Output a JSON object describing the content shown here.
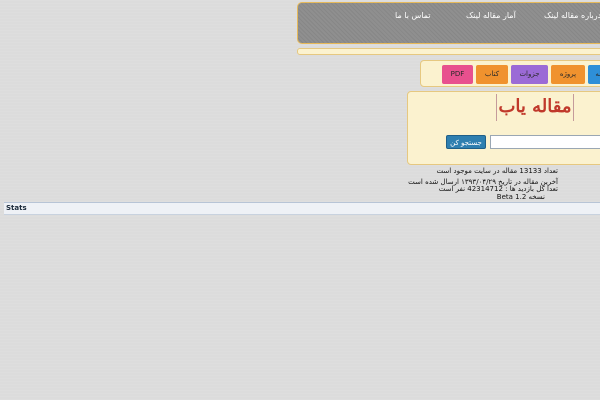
{
  "nav": {
    "items": [
      {
        "label": "درباره مقاله لینک"
      },
      {
        "label": "آمار مقاله لینک"
      },
      {
        "label": "تماس با ما"
      }
    ]
  },
  "categories": {
    "items": [
      {
        "label": "PDF",
        "color": "#e8508e"
      },
      {
        "label": "کتاب",
        "color": "#f0922e"
      },
      {
        "label": "جزوات",
        "color": "#9b6ad6"
      },
      {
        "label": "پروژه",
        "color": "#f0922e"
      },
      {
        "label": "مقاله",
        "color": "#2e8fd8"
      }
    ]
  },
  "search": {
    "logo_text": "مقاله یاب",
    "button_label": "جستجو کن",
    "input_value": ""
  },
  "info": {
    "article_count": "تعداد 13133 مقاله در سایت موجود است",
    "last_article": "آخرین مقاله در تاریخ ۱۳۹۳/۰۴/۲۹ ارسال شده است",
    "visitors": "تعدا کل بازدید ها : 42314712 نفر است",
    "version": "نسخه Beta 1.2"
  },
  "stats": {
    "label": "Stats"
  }
}
